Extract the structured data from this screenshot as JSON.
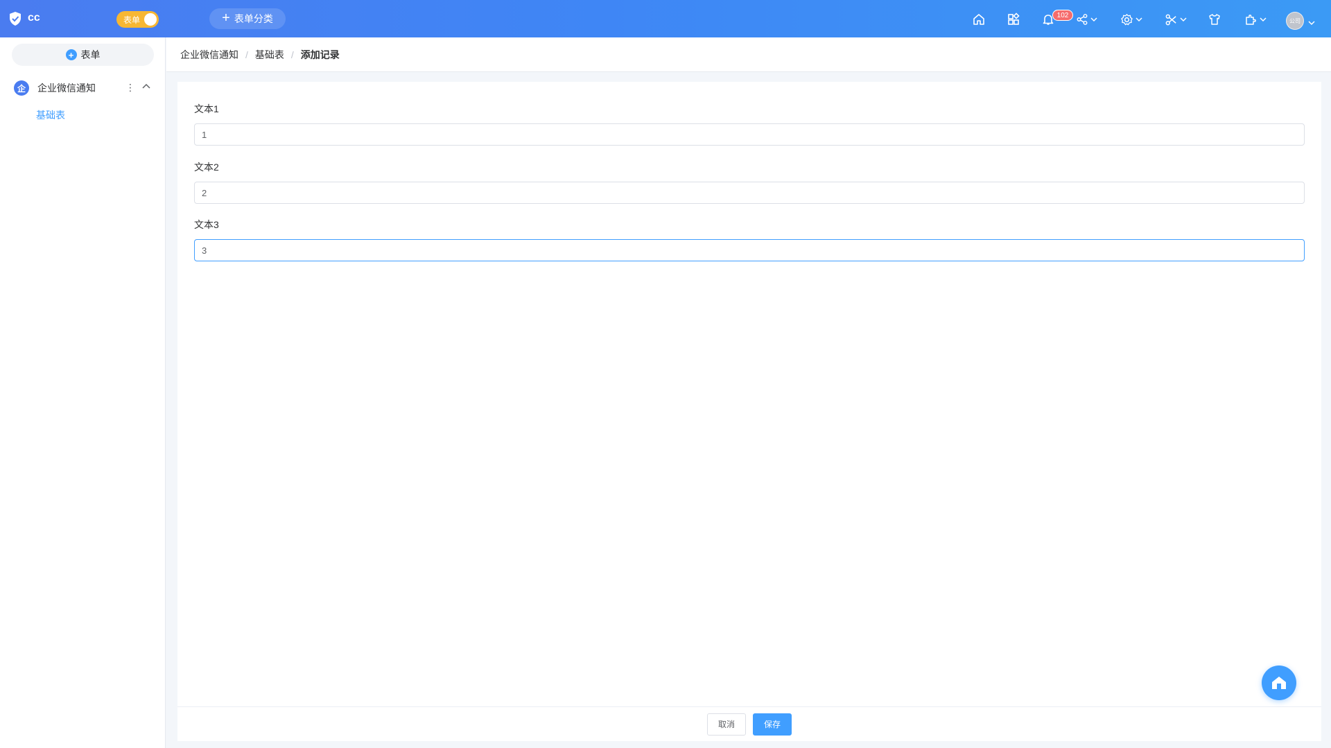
{
  "header": {
    "app_name": "cc",
    "mode_switch_label": "表单",
    "category_button_label": "表单分类",
    "notification_count": "102",
    "avatar_text": "公司",
    "icons": [
      "home-icon",
      "apps-grid-icon",
      "bell-icon",
      "share-icon",
      "settings-icon",
      "tools-icon",
      "shirt-icon",
      "plugin-icon"
    ]
  },
  "sidebar": {
    "add_button_label": "表单",
    "group": {
      "icon_text": "企",
      "label": "企业微信通知",
      "more": "⋮"
    },
    "items": [
      {
        "label": "基础表",
        "active": true
      }
    ]
  },
  "breadcrumb": [
    "企业微信通知",
    "基础表",
    "添加记录"
  ],
  "form": {
    "fields": [
      {
        "label": "文本1",
        "value": "1"
      },
      {
        "label": "文本2",
        "value": "2"
      },
      {
        "label": "文本3",
        "value": "3",
        "focused": true
      }
    ],
    "cancel_label": "取消",
    "save_label": "保存"
  },
  "colors": {
    "header_gradient_start": "#4a7cf0",
    "header_gradient_end": "#3b9af5",
    "primary": "#409eff",
    "switch": "#f7b733",
    "badge": "#f56c6c"
  }
}
